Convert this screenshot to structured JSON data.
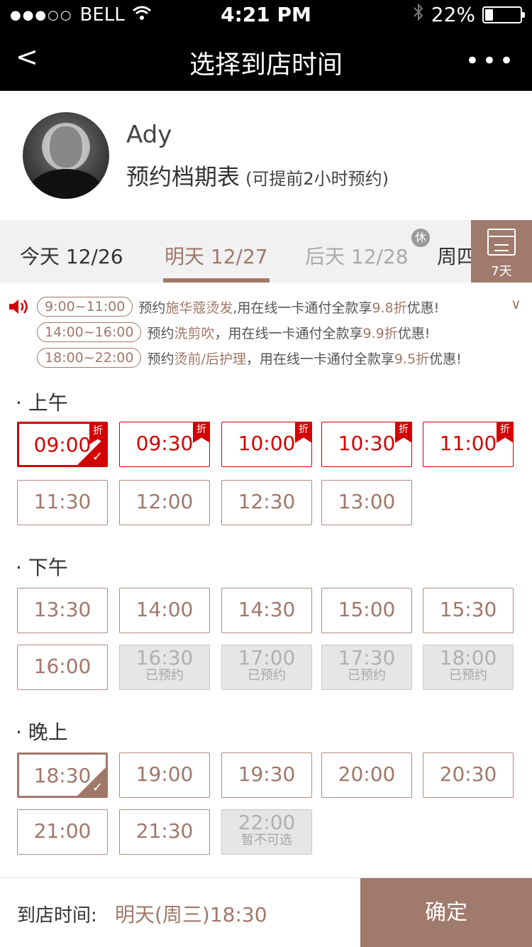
{
  "status_bar": {
    "signal": "●●●○○",
    "carrier": "BELL",
    "time": "4:21 PM",
    "battery_percent": "22%",
    "battery_level": 0.22
  },
  "nav": {
    "back": "<",
    "title": "选择到店时间",
    "more": "•••"
  },
  "profile": {
    "name": "Ady",
    "subtitle": "预约档期表",
    "note": "(可提前2小时预约)"
  },
  "tabs": [
    {
      "label": "今天 12/26"
    },
    {
      "label": "明天 12/27"
    },
    {
      "label": "后天 12/28"
    },
    {
      "label": "周四"
    }
  ],
  "rest_badge": "休",
  "calendar_button": {
    "label": "7天"
  },
  "promos": [
    {
      "time": "9:00~11:00",
      "pre": "预约",
      "hl": "施华蔻烫发",
      "mid": ",用在线一卡通付全款享",
      "hl2": "9.8折",
      "post": "优惠!"
    },
    {
      "time": "14:00~16:00",
      "pre": "预约",
      "hl": "洗剪吹",
      "mid": "，用在线一卡通付全款享",
      "hl2": "9.9折",
      "post": "优惠!"
    },
    {
      "time": "18:00~22:00",
      "pre": "预约",
      "hl": "烫前/后护理",
      "mid": "，用在线一卡通付全款享",
      "hl2": "9.5折",
      "post": "优惠!"
    }
  ],
  "expand_icon": "∨",
  "discount_tag": "折",
  "sections": {
    "morning": {
      "title": "· 上午",
      "slots": [
        "09:00",
        "09:30",
        "10:00",
        "10:30",
        "11:00",
        "11:30",
        "12:00",
        "12:30",
        "13:00"
      ]
    },
    "afternoon": {
      "title": "· 下午",
      "slots": [
        "13:30",
        "14:00",
        "14:30",
        "15:00",
        "15:30",
        "16:00",
        "16:30",
        "17:00",
        "17:30",
        "18:00"
      ],
      "booked_label": "已预约"
    },
    "evening": {
      "title": "· 晚上",
      "slots": [
        "18:30",
        "19:00",
        "19:30",
        "20:00",
        "20:30",
        "21:00",
        "21:30",
        "22:00"
      ],
      "unavailable_label": "暂不可选"
    }
  },
  "footer": {
    "label": "到店时间:",
    "value": "明天(周三)18:30",
    "confirm": "确定"
  }
}
